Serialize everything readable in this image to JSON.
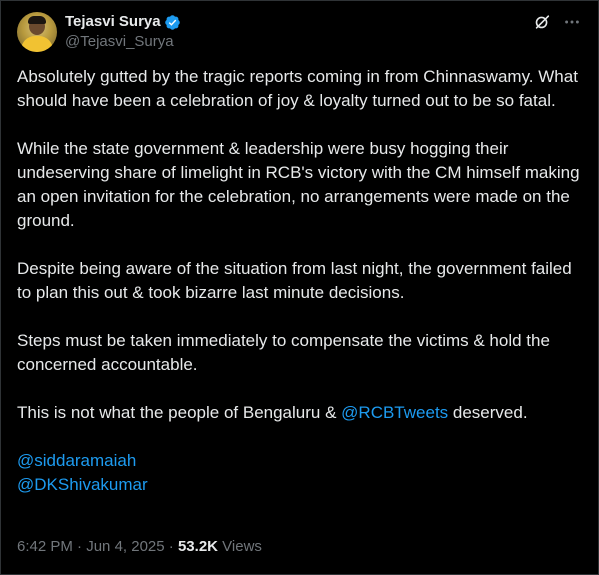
{
  "author": {
    "display_name": "Tejasvi Surya",
    "handle": "@Tejasvi_Surya",
    "verified_icon": "verified-badge-icon"
  },
  "header": {
    "grok_icon": "grok-icon",
    "more_icon": "more-icon"
  },
  "tweet": {
    "p1": "Absolutely gutted by the tragic reports coming in from Chinnaswamy. What should have been a celebration of joy & loyalty turned out to be so fatal.",
    "p2": "While the state government & leadership were busy hogging their undeserving share of limelight in RCB's victory with the CM himself making an open invitation for the celebration, no arrangements were made on the ground.",
    "p3": "Despite being aware of the situation from last night, the government failed to plan this out & took bizarre last minute decisions.",
    "p4": "Steps must be taken immediately to compensate the victims & hold the concerned accountable.",
    "p5_before": "This is not what the people of Bengaluru & ",
    "p5_mention": "@RCBTweets",
    "p5_after": " deserved.",
    "mention1": "@siddaramaiah",
    "mention2": "@DKShivakumar"
  },
  "meta": {
    "time": "6:42 PM",
    "separator1": " · ",
    "date": "Jun 4, 2025",
    "separator2": " · ",
    "views_count": "53.2K",
    "views_label": " Views"
  },
  "colors": {
    "background": "#000000",
    "text": "#e7e9ea",
    "secondary": "#71767b",
    "link": "#1d9bf0"
  }
}
